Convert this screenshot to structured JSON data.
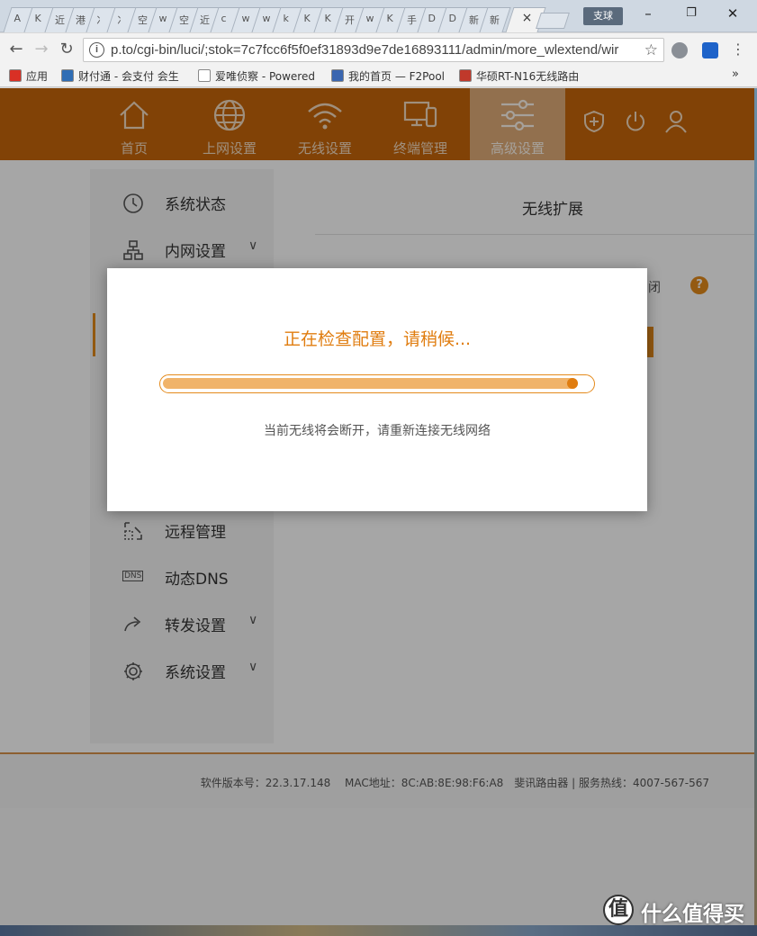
{
  "browser": {
    "tabs": [
      "A",
      "K",
      "近",
      "港",
      "冫",
      "冫",
      "空",
      "w",
      "空",
      "近",
      "c",
      "w",
      "w",
      "k",
      "K",
      "K",
      "开",
      "w",
      "K",
      "手",
      "D",
      "D",
      "新",
      "新"
    ],
    "active_tab_close": "×",
    "user_chip": "支球",
    "window_controls": {
      "minimize": "–",
      "restore": "❐",
      "close": "✕"
    },
    "url": "p.to/cgi-bin/luci/;stok=7c7fcc6f5f0ef31893d9e7de16893111/admin/more_wlextend/wir",
    "bookmarks": [
      {
        "label": "应用",
        "icon": "apps-grid-icon",
        "color": "#d93025"
      },
      {
        "label": "财付通 - 会支付 会生",
        "icon": "shield-icon",
        "color": "#2f6db5"
      },
      {
        "label": "爱唯侦察 - Powered",
        "icon": "page-icon",
        "color": "#ffffff"
      },
      {
        "label": "我的首页 — F2Pool",
        "icon": "f2pool-icon",
        "color": "#3a66b0"
      },
      {
        "label": "华硕RT-N16无线路由",
        "icon": "asus-icon",
        "color": "#c0392b"
      }
    ],
    "bookmarks_more": "»"
  },
  "router": {
    "nav": [
      {
        "label": "首页",
        "icon": "home-icon",
        "active": false
      },
      {
        "label": "上网设置",
        "icon": "globe-icon",
        "active": false
      },
      {
        "label": "无线设置",
        "icon": "wifi-icon",
        "active": false
      },
      {
        "label": "终端管理",
        "icon": "devices-icon",
        "active": false
      },
      {
        "label": "高级设置",
        "icon": "sliders-icon",
        "active": true
      }
    ],
    "header_icons": [
      "shield-plus-icon",
      "power-icon",
      "user-icon"
    ],
    "sidebar": [
      {
        "label": "系统状态",
        "icon": "clock-icon",
        "has_children": false
      },
      {
        "label": "内网设置",
        "icon": "network-icon",
        "has_children": true
      },
      {
        "label": "远程管理",
        "icon": "remote-icon",
        "has_children": false
      },
      {
        "label": "动态DNS",
        "icon": "dns-icon",
        "has_children": false
      },
      {
        "label": "转发设置",
        "icon": "forward-icon",
        "has_children": true
      },
      {
        "label": "系统设置",
        "icon": "gear-icon",
        "has_children": true
      }
    ],
    "dns_badge": "DNS",
    "page_title": "无线扩展",
    "partial_text": "闭",
    "help": "?",
    "footer": "软件版本号：22.3.17.148　 MAC地址：8C:AB:8E:98:F6:A8　斐讯路由器 | 服务热线：4007-567-567"
  },
  "modal": {
    "message": "正在检查配置，请稍候...",
    "progress": 0.97,
    "hint": "当前无线将会断开，请重新连接无线网络"
  },
  "watermark": {
    "symbol": "值",
    "text": "什么值得买"
  },
  "colors": {
    "brand": "#c6660a",
    "accent": "#e48a1b",
    "progress_fill": "#f0b36a"
  }
}
